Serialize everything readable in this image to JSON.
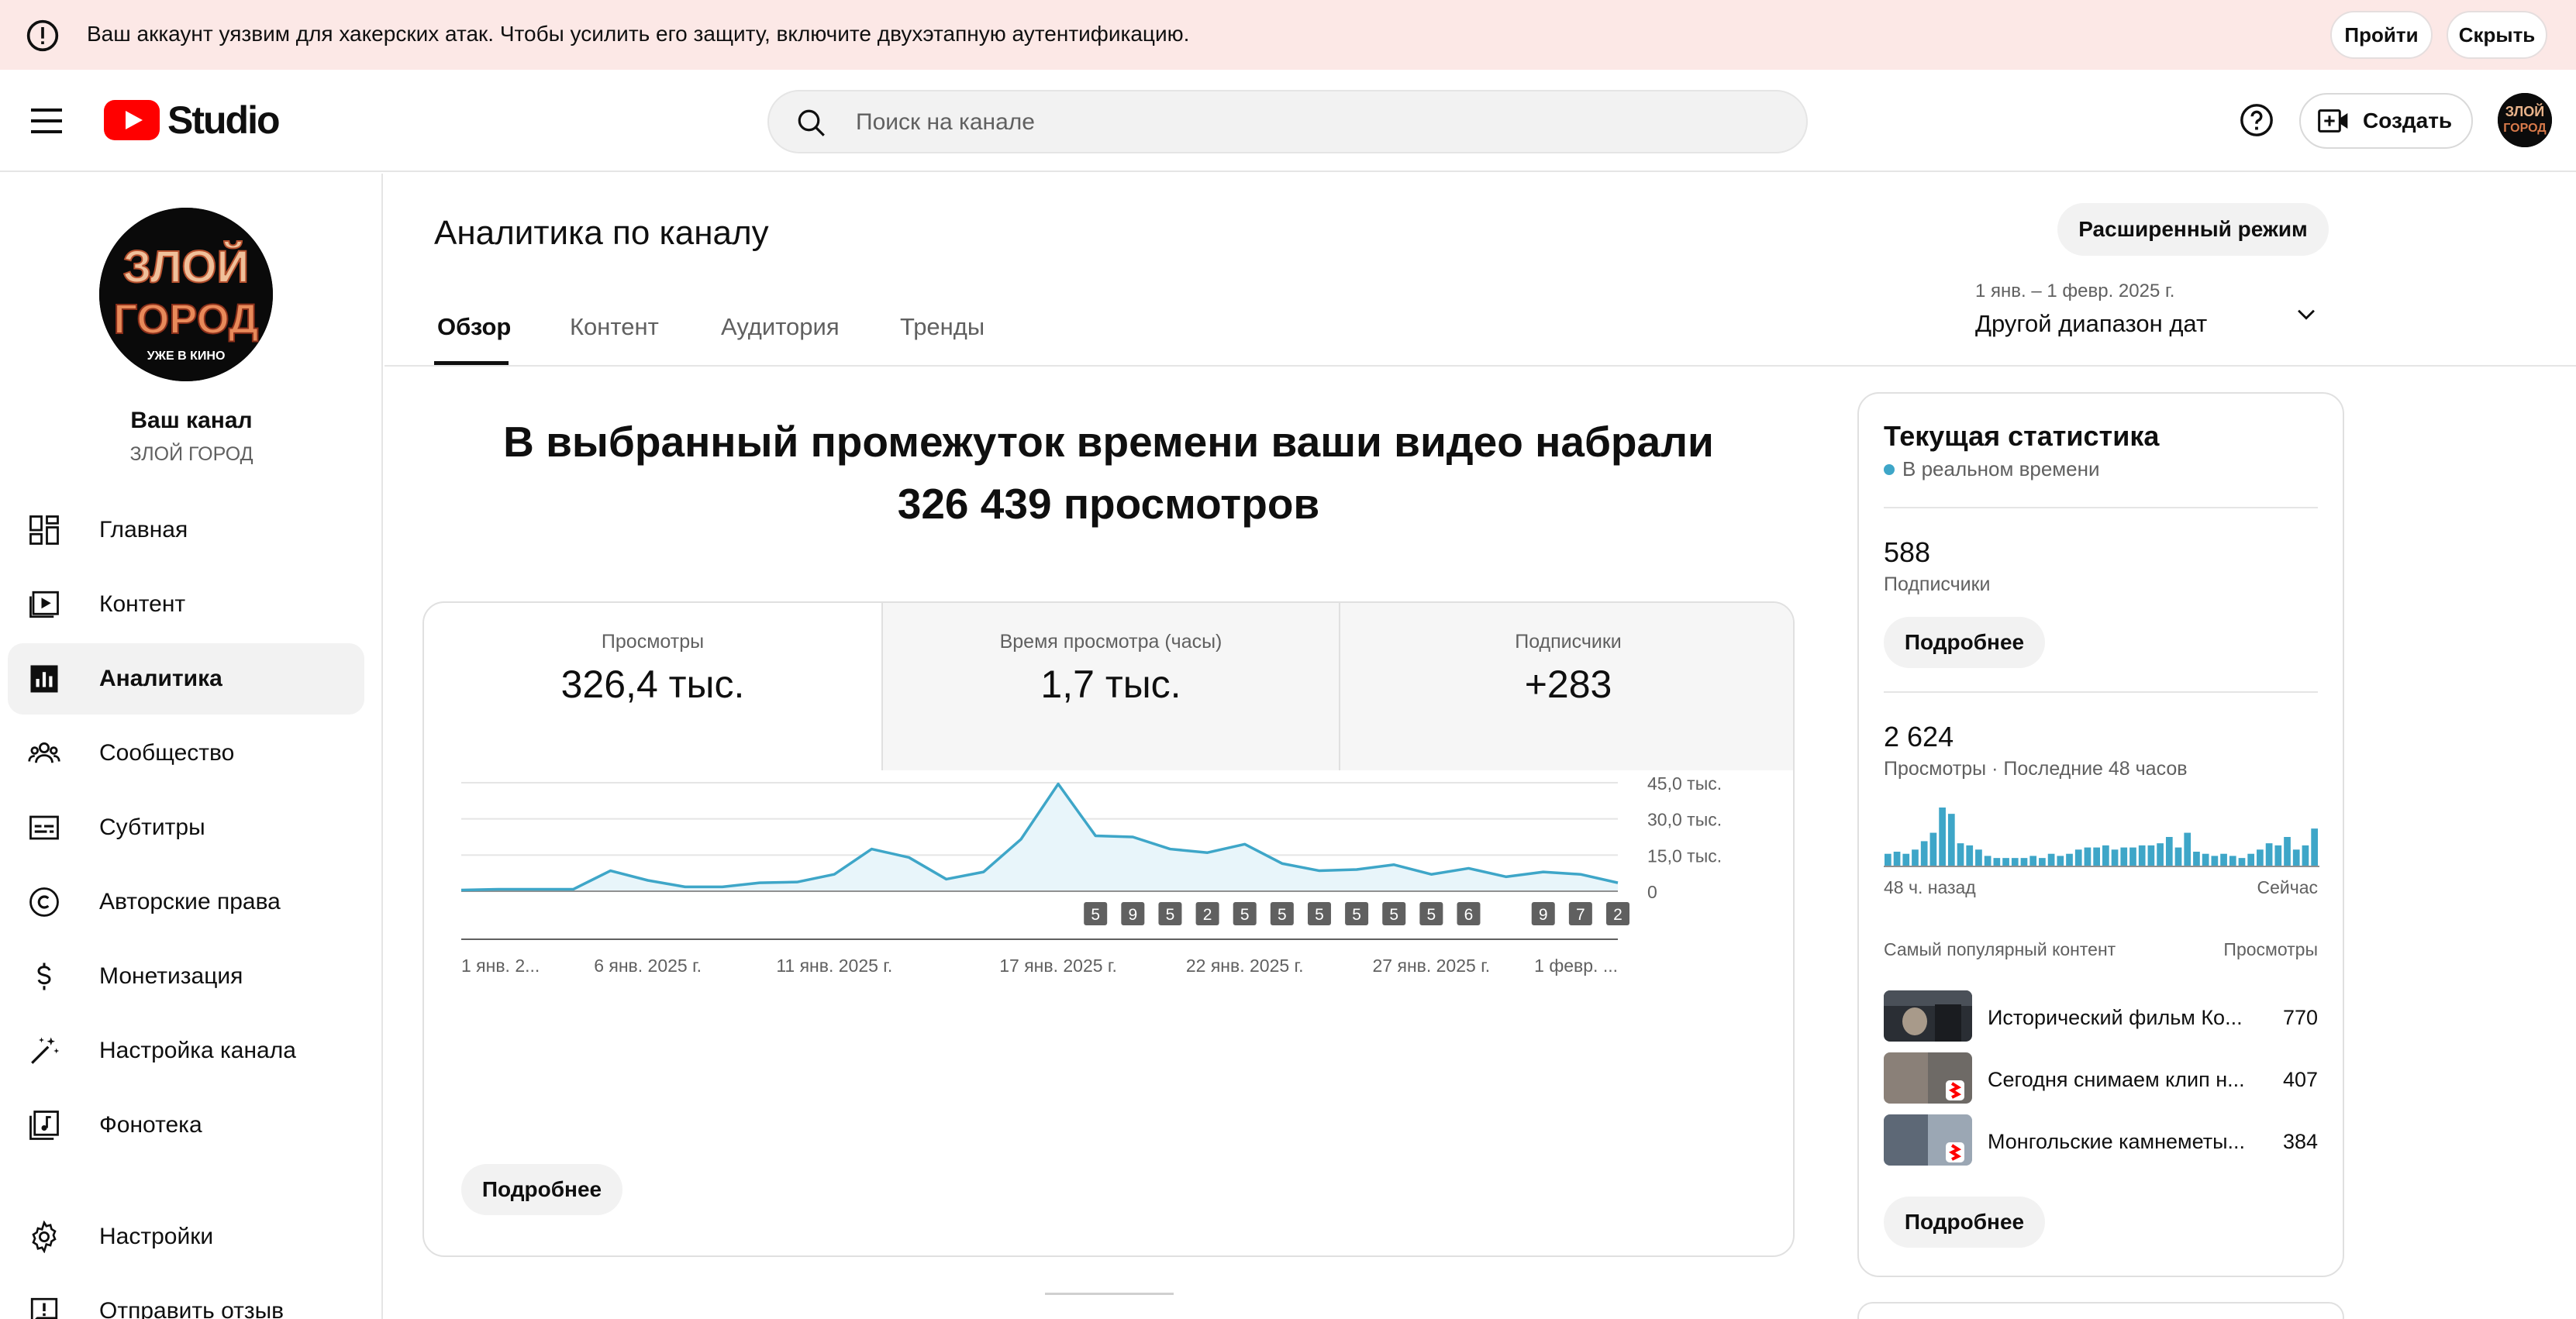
{
  "banner": {
    "text": "Ваш аккаунт уязвим для хакерских атак. Чтобы усилить его защиту, включите двухэтапную аутентификацию.",
    "go_label": "Пройти",
    "hide_label": "Скрыть"
  },
  "header": {
    "logo_text": "Studio",
    "search_placeholder": "Поиск на канале",
    "create_label": "Создать"
  },
  "channel": {
    "heading": "Ваш канал",
    "name": "ЗЛОЙ ГОРОД",
    "avatar_art_lines": [
      "ЗЛОЙ",
      "ГОРОД",
      "УЖЕ В КИНО"
    ]
  },
  "sidebar": {
    "items": [
      {
        "label": "Главная",
        "icon": "dashboard-icon"
      },
      {
        "label": "Контент",
        "icon": "content-icon"
      },
      {
        "label": "Аналитика",
        "icon": "analytics-icon",
        "active": true
      },
      {
        "label": "Сообщество",
        "icon": "community-icon"
      },
      {
        "label": "Субтитры",
        "icon": "subtitles-icon"
      },
      {
        "label": "Авторские права",
        "icon": "copyright-icon"
      },
      {
        "label": "Монетизация",
        "icon": "monetization-icon"
      },
      {
        "label": "Настройка канала",
        "icon": "customization-icon"
      },
      {
        "label": "Фонотека",
        "icon": "audio-library-icon"
      },
      {
        "label": "Настройки",
        "icon": "settings-icon"
      },
      {
        "label": "Отправить отзыв",
        "icon": "feedback-icon"
      }
    ]
  },
  "main": {
    "title": "Аналитика по каналу",
    "advanced_label": "Расширенный режим",
    "tabs": [
      {
        "label": "Обзор",
        "active": true
      },
      {
        "label": "Контент"
      },
      {
        "label": "Аудитория"
      },
      {
        "label": "Тренды"
      }
    ],
    "date_range_sub": "1 янв. – 1 февр. 2025 г.",
    "date_range_main": "Другой диапазон дат",
    "headline_line1": "В выбранный промежуток времени ваши видео набрали",
    "headline_line2": "326 439 просмотров",
    "metrics": [
      {
        "label": "Просмотры",
        "value": "326,4 тыс."
      },
      {
        "label": "Время просмотра (часы)",
        "value": "1,7 тыс."
      },
      {
        "label": "Подписчики",
        "value": "+283"
      }
    ],
    "more_label": "Подробнее"
  },
  "chart_data": {
    "type": "area",
    "x": [
      "1 янв.",
      "2 янв.",
      "3 янв.",
      "4 янв.",
      "5 янв.",
      "6 янв.",
      "7 янв.",
      "8 янв.",
      "9 янв.",
      "10 янв.",
      "11 янв.",
      "12 янв.",
      "13 янв.",
      "14 янв.",
      "15 янв.",
      "16 янв.",
      "17 янв.",
      "18 янв.",
      "19 янв.",
      "20 янв.",
      "21 янв.",
      "22 янв.",
      "23 янв.",
      "24 янв.",
      "25 янв.",
      "26 янв.",
      "27 янв.",
      "28 янв.",
      "29 янв.",
      "30 янв.",
      "31 янв.",
      "1 февр."
    ],
    "values": [
      500,
      800,
      800,
      800,
      8500,
      4500,
      1800,
      1800,
      3500,
      3800,
      7000,
      17500,
      14000,
      5000,
      8000,
      21500,
      44500,
      23000,
      22500,
      17500,
      16000,
      19500,
      11500,
      8500,
      9000,
      11000,
      7000,
      9500,
      6000,
      8000,
      7000,
      3500
    ],
    "ylim": [
      0,
      45000
    ],
    "y_ticks": [
      {
        "value": 45000,
        "label": "45,0 тыс."
      },
      {
        "value": 30000,
        "label": "30,0 тыс."
      },
      {
        "value": 15000,
        "label": "15,0 тыс."
      },
      {
        "value": 0,
        "label": "0"
      }
    ],
    "x_tick_labels": [
      {
        "index": 0,
        "label": "1 янв. 2..."
      },
      {
        "index": 5,
        "label": "6 янв. 2025 г."
      },
      {
        "index": 10,
        "label": "11 янв. 2025 г."
      },
      {
        "index": 16,
        "label": "17 янв. 2025 г."
      },
      {
        "index": 21,
        "label": "22 янв. 2025 г."
      },
      {
        "index": 26,
        "label": "27 янв. 2025 г."
      },
      {
        "index": 31,
        "label": "1 февр. ..."
      }
    ],
    "upload_markers": [
      {
        "index": 17,
        "count": "5"
      },
      {
        "index": 18,
        "count": "9"
      },
      {
        "index": 19,
        "count": "5"
      },
      {
        "index": 20,
        "count": "2"
      },
      {
        "index": 21,
        "count": "5"
      },
      {
        "index": 22,
        "count": "5"
      },
      {
        "index": 23,
        "count": "5"
      },
      {
        "index": 24,
        "count": "5"
      },
      {
        "index": 25,
        "count": "5"
      },
      {
        "index": 26,
        "count": "5"
      },
      {
        "index": 27,
        "count": "6"
      },
      {
        "index": 29,
        "count": "9"
      },
      {
        "index": 30,
        "count": "7"
      },
      {
        "index": 31,
        "count": "2"
      }
    ],
    "colors": {
      "line": "#3ea6c8",
      "fill": "#e8f5fa",
      "grid": "#e5e5e5",
      "marker_bg": "#606060"
    }
  },
  "realtime": {
    "title": "Текущая статистика",
    "live_label": "В реальном времени",
    "subscribers_value": "588",
    "subscribers_label": "Подписчики",
    "more_label": "Подробнее",
    "views_value": "2 624",
    "views_label": "Просмотры · Последние 48 часов",
    "bars_start_label": "48 ч. назад",
    "bars_end_label": "Сейчас",
    "bars": [
      6,
      7,
      6,
      8,
      12,
      16,
      28,
      25,
      11,
      10,
      8,
      5,
      4,
      4,
      4,
      4,
      5,
      4,
      6,
      5,
      6,
      8,
      9,
      9,
      10,
      8,
      9,
      9,
      10,
      10,
      11,
      14,
      9,
      16,
      7,
      6,
      5,
      6,
      5,
      4,
      6,
      8,
      11,
      10,
      14,
      8,
      10,
      18
    ],
    "top_header_left": "Самый популярный контент",
    "top_header_right": "Просмотры",
    "top_items": [
      {
        "title": "Исторический фильм Ко...",
        "views": "770"
      },
      {
        "title": "Сегодня снимаем клип н...",
        "views": "407"
      },
      {
        "title": "Монгольские камнеметы...",
        "views": "384"
      }
    ],
    "bar_color": "#3ea6c8"
  }
}
